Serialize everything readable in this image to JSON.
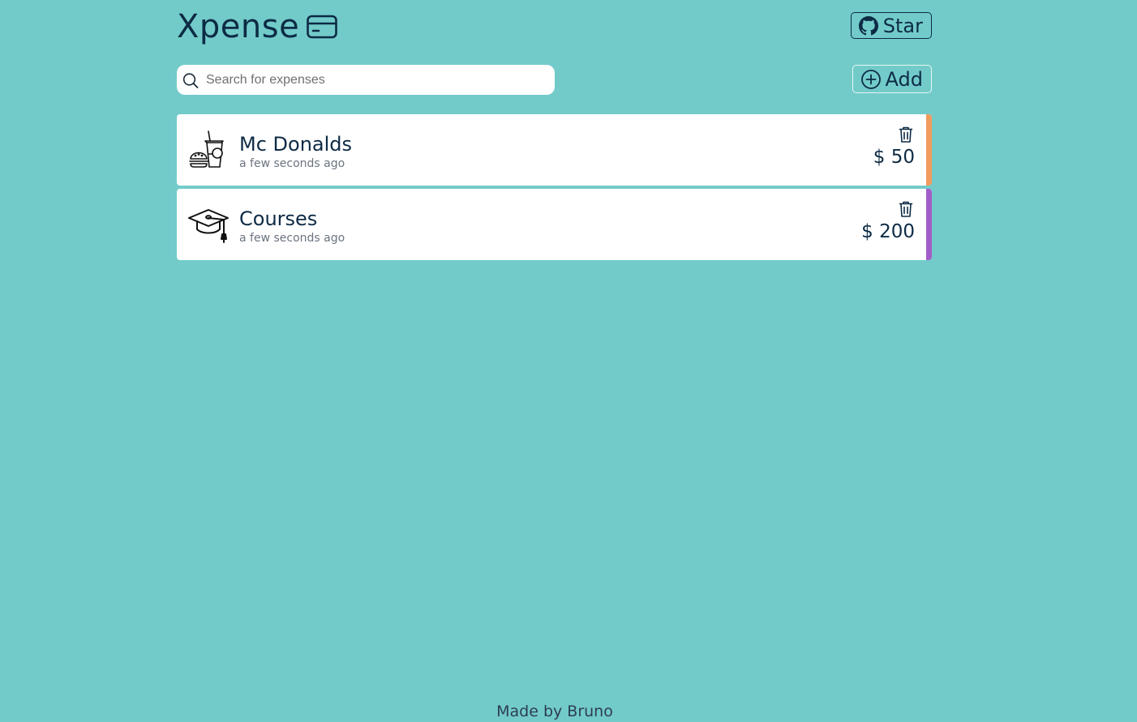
{
  "app": {
    "title": "Xpense",
    "icon": "credit-card-icon"
  },
  "header": {
    "star_label": "Star",
    "star_icon": "github-icon"
  },
  "search": {
    "placeholder": "Search for expenses",
    "value": ""
  },
  "toolbar": {
    "add_label": "Add",
    "add_icon": "plus-circle-icon"
  },
  "expenses": [
    {
      "title": "Mc Donalds",
      "time": "a few seconds ago",
      "amount": "$ 50",
      "icon": "fast-food-icon",
      "color": "#f39a5e"
    },
    {
      "title": "Courses",
      "time": "a few seconds ago",
      "amount": "$ 200",
      "icon": "graduation-cap-icon",
      "color": "#a25ec8"
    }
  ],
  "footer": {
    "text": "Made by Bruno"
  },
  "colors": {
    "background": "#72cbc9",
    "text": "#0d2b45"
  }
}
